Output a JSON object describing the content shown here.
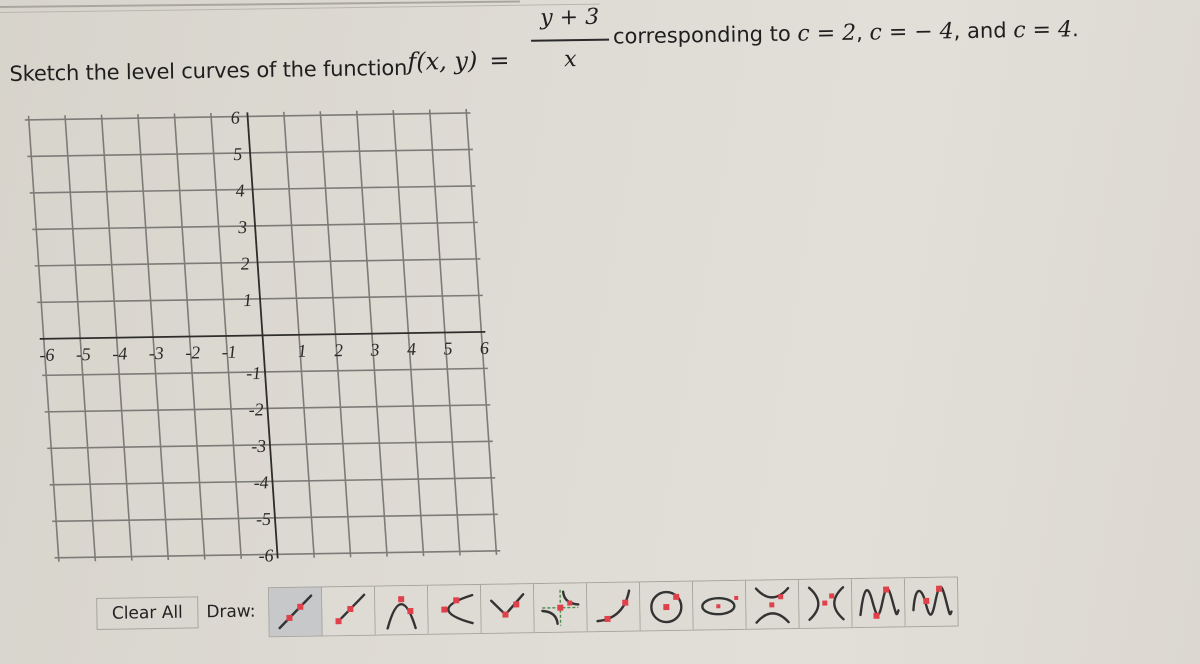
{
  "prompt": {
    "lead": "Sketch the level curves of the function",
    "function_lhs": "f(x, y)",
    "equals": "=",
    "fraction_numerator": "y + 3",
    "fraction_denominator": "x",
    "tail_text": "corresponding to",
    "c_values_text": [
      {
        "label": "c = 2",
        "sep": ", "
      },
      {
        "label": "c = − 4",
        "sep": ", and "
      },
      {
        "label": "c = 4",
        "sep": "."
      }
    ]
  },
  "graph": {
    "x_range": [
      -6,
      6
    ],
    "y_range": [
      -6,
      6
    ],
    "grid_step": 1,
    "x_tick_labels": [
      "-6",
      "-5",
      "-4",
      "-3",
      "-2",
      "-1",
      "1",
      "2",
      "3",
      "4",
      "5",
      "6"
    ],
    "y_tick_labels_positive": [
      "6",
      "5",
      "4",
      "3",
      "2",
      "1"
    ],
    "y_tick_labels_negative": [
      "-1",
      "-2",
      "-3",
      "-4",
      "-5",
      "-6"
    ]
  },
  "toolbar": {
    "clear_all_label": "Clear All",
    "draw_label": "Draw:",
    "active_tool": "line",
    "tools": [
      {
        "id": "line",
        "name": "line-tool"
      },
      {
        "id": "ray",
        "name": "ray-tool"
      },
      {
        "id": "parabola-vertical",
        "name": "parabola-vertical-tool"
      },
      {
        "id": "parabola-horizontal",
        "name": "parabola-horizontal-tool"
      },
      {
        "id": "absolute-value",
        "name": "absolute-value-tool"
      },
      {
        "id": "reciprocal",
        "name": "reciprocal-tool"
      },
      {
        "id": "exponential",
        "name": "exponential-tool"
      },
      {
        "id": "circle",
        "name": "circle-tool"
      },
      {
        "id": "ellipse",
        "name": "ellipse-tool"
      },
      {
        "id": "hyperbola-vertical",
        "name": "hyperbola-vertical-tool"
      },
      {
        "id": "hyperbola-horizontal",
        "name": "hyperbola-horizontal-tool"
      },
      {
        "id": "sine",
        "name": "sine-tool"
      },
      {
        "id": "cosine",
        "name": "cosine-tool"
      }
    ]
  },
  "colors": {
    "point_marker": "#e0404a",
    "asymptote": "#4c8a4c",
    "active_tool_bg": "#c6c8ca"
  }
}
